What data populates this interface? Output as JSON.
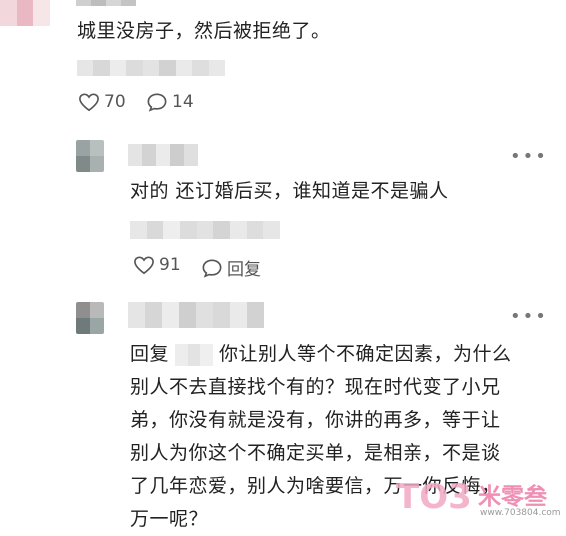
{
  "top_comment": {
    "text": "城里没房子，然后被拒绝了。",
    "like_count": "70",
    "reply_count": "14"
  },
  "reply_1": {
    "text": "对的 还订婚后买，谁知道是不是骗人",
    "like_count": "91",
    "reply_label": "回复"
  },
  "reply_2": {
    "text_line_1": "回复",
    "text_line_1_rest": "你让别人等个不确定因素，为什么",
    "text_line_2": "别人不去直接找个有的？现在时代变了小兄",
    "text_line_3": "弟，你没有就是没有，你讲的再多，等于让",
    "text_line_4": "别人为你这个不确定买单，是相亲，不是谈",
    "text_line_5": "了几年恋爱，别人为啥要信，万一你反悔，",
    "text_line_6": "万一呢？"
  },
  "more_glyph": "•••",
  "watermark": {
    "logo_text": "TO3",
    "name": "米零叁",
    "url": "www.703804.com"
  },
  "icons": [
    "heart-icon",
    "comment-icon"
  ],
  "colors": {
    "text": "#222222",
    "meta": "#555555",
    "watermark_pink": "#f3a7c4",
    "watermark_blue": "#5fb0e8"
  }
}
